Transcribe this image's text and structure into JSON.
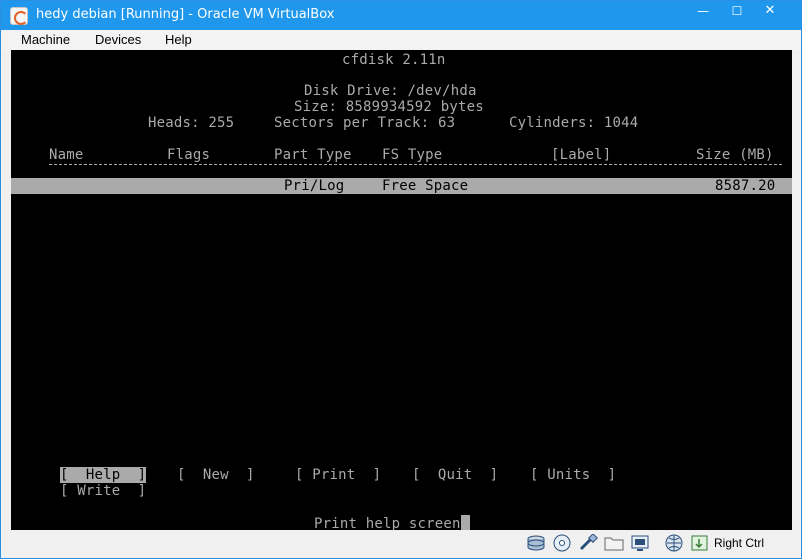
{
  "window": {
    "title": "hedy debian [Running] - Oracle VM VirtualBox",
    "minimize_label": "—",
    "maximize_label": "☐",
    "close_label": "✕",
    "accent": "#1f97ec"
  },
  "menubar": {
    "items": [
      {
        "label": "Machine"
      },
      {
        "label": "Devices"
      },
      {
        "label": "Help"
      }
    ]
  },
  "cfdisk": {
    "title": "cfdisk 2.11n",
    "disk_drive": "Disk Drive: /dev/hda",
    "size": "Size: 8589934592 bytes",
    "heads": "Heads: 255",
    "sectors": "Sectors per Track: 63",
    "cylinders": "Cylinders: 1044",
    "columns": {
      "name": "Name",
      "flags": "Flags",
      "part_type": "Part Type",
      "fs_type": "FS Type",
      "label": "[Label]",
      "size": "Size (MB)"
    },
    "rows": [
      {
        "name": "",
        "flags": "",
        "part_type": "Pri/Log",
        "fs_type": "Free Space",
        "label": "",
        "size": "8587.20"
      }
    ],
    "commands": [
      {
        "label": "[  Help  ]",
        "selected": true
      },
      {
        "label": "[  New  ]",
        "selected": false
      },
      {
        "label": "[ Print  ]",
        "selected": false
      },
      {
        "label": "[  Quit  ]",
        "selected": false
      },
      {
        "label": "[ Units  ]",
        "selected": false
      },
      {
        "label": "[ Write  ]",
        "selected": false
      }
    ],
    "status_line": "Print help screen"
  },
  "statusbar": {
    "host_key": "Right Ctrl",
    "icons": [
      "hard-disk-icon",
      "optical-drive-icon",
      "usb-icon",
      "shared-folders-icon",
      "display-icon",
      "network-icon",
      "host-key-icon"
    ]
  }
}
